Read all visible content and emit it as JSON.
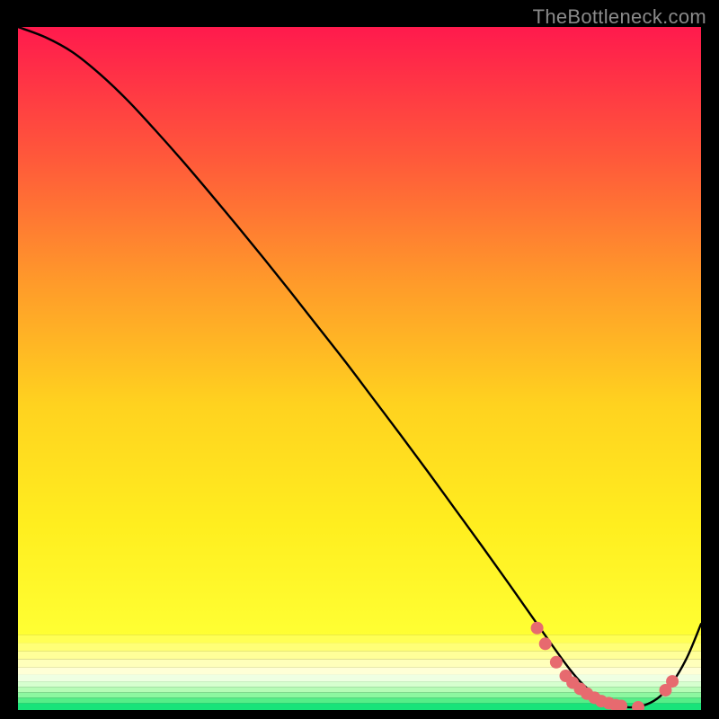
{
  "watermark": "TheBottleneck.com",
  "chart_data": {
    "type": "line",
    "title": "",
    "xlabel": "",
    "ylabel": "",
    "xlim": [
      0,
      100
    ],
    "ylim": [
      0,
      100
    ],
    "grid": false,
    "legend": false,
    "series": [
      {
        "name": "curve",
        "x": [
          0,
          4,
          8,
          12,
          16,
          20,
          24,
          28,
          32,
          36,
          40,
          44,
          48,
          52,
          56,
          60,
          64,
          68,
          72,
          76,
          80,
          82,
          84,
          86,
          88,
          90,
          92,
          94,
          96,
          98,
          100
        ],
        "y": [
          100,
          98.5,
          96.3,
          93.1,
          89.3,
          85.0,
          80.5,
          75.8,
          71.0,
          66.1,
          61.1,
          56.0,
          50.9,
          45.6,
          40.3,
          34.9,
          29.4,
          23.9,
          18.3,
          12.6,
          7.0,
          4.5,
          2.6,
          1.3,
          0.6,
          0.4,
          0.8,
          2.0,
          4.3,
          7.8,
          12.6
        ]
      }
    ],
    "markers": {
      "name": "dots",
      "color": "#e76a6f",
      "x": [
        76.0,
        77.2,
        78.8,
        80.2,
        81.2,
        82.3,
        83.3,
        84.4,
        85.4,
        86.5,
        87.5,
        88.3,
        90.8,
        94.8,
        95.8
      ],
      "y": [
        12.0,
        9.7,
        7.0,
        5.0,
        4.0,
        3.1,
        2.4,
        1.8,
        1.3,
        1.0,
        0.7,
        0.6,
        0.4,
        2.9,
        4.2
      ]
    },
    "bands": [
      {
        "y0": 100,
        "y1": 11.0,
        "stops": [
          {
            "t": 0.0,
            "c": "#ff1a4d"
          },
          {
            "t": 0.22,
            "c": "#ff5a3a"
          },
          {
            "t": 0.42,
            "c": "#ff9a2a"
          },
          {
            "t": 0.62,
            "c": "#ffd21f"
          },
          {
            "t": 0.82,
            "c": "#ffee1f"
          },
          {
            "t": 1.0,
            "c": "#ffff33"
          }
        ]
      },
      {
        "y0": 11.0,
        "y1": 9.8,
        "color": "#ffff55"
      },
      {
        "y0": 9.8,
        "y1": 8.6,
        "color": "#ffff77"
      },
      {
        "y0": 8.6,
        "y1": 7.4,
        "color": "#ffff99"
      },
      {
        "y0": 7.4,
        "y1": 6.2,
        "color": "#ffffbb"
      },
      {
        "y0": 6.2,
        "y1": 5.2,
        "color": "#ffffd6"
      },
      {
        "y0": 5.2,
        "y1": 4.2,
        "color": "#efffe2"
      },
      {
        "y0": 4.2,
        "y1": 3.4,
        "color": "#d6ffcf"
      },
      {
        "y0": 3.4,
        "y1": 2.6,
        "color": "#b6fcb6"
      },
      {
        "y0": 2.6,
        "y1": 1.8,
        "color": "#8df7a0"
      },
      {
        "y0": 1.8,
        "y1": 1.0,
        "color": "#55ee88"
      },
      {
        "y0": 1.0,
        "y1": 0.0,
        "color": "#18e37a"
      }
    ]
  }
}
